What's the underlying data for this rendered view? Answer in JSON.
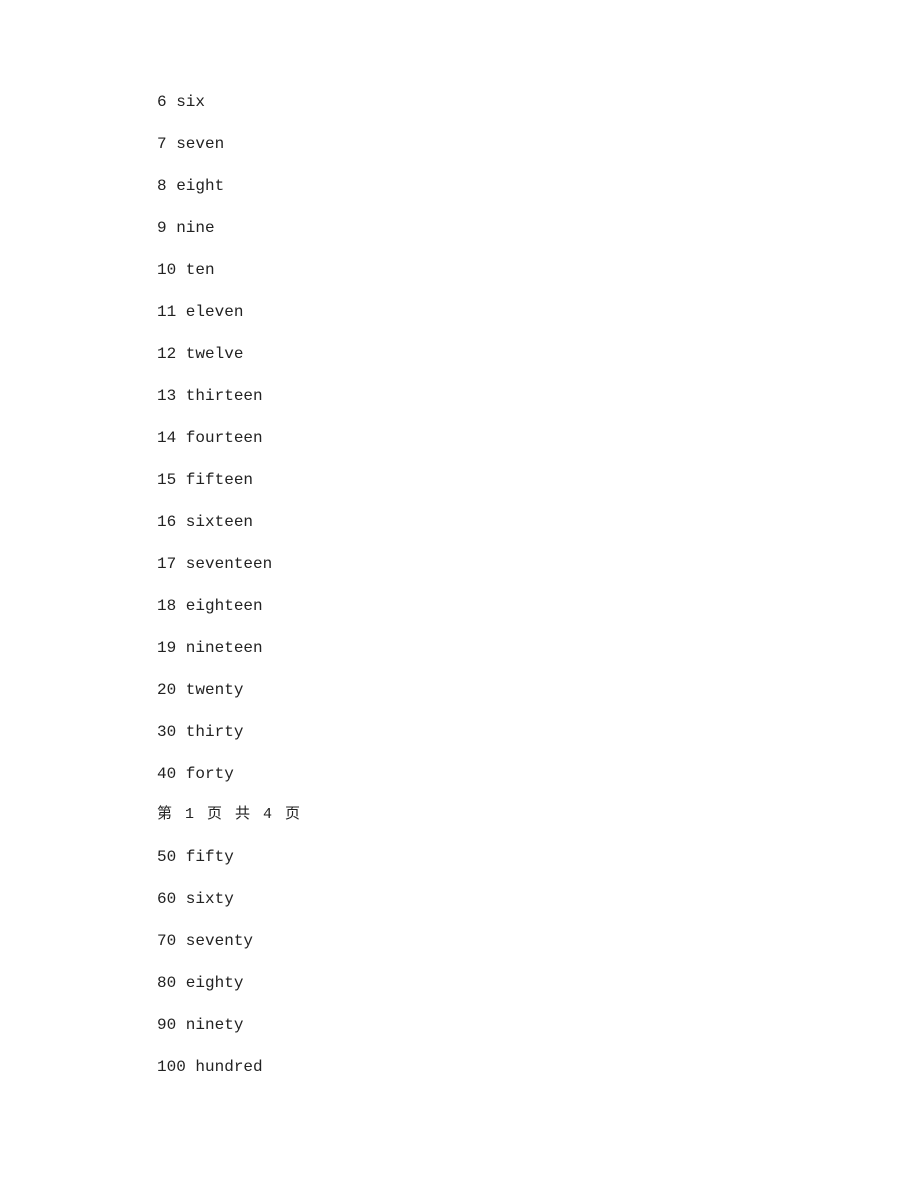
{
  "items": [
    {
      "number": "6",
      "word": "six"
    },
    {
      "number": "7",
      "word": "seven"
    },
    {
      "number": "8",
      "word": "eight"
    },
    {
      "number": "9",
      "word": "nine"
    },
    {
      "number": "10",
      "word": "ten"
    },
    {
      "number": "11",
      "word": "eleven"
    },
    {
      "number": "12",
      "word": "twelve"
    },
    {
      "number": "13",
      "word": "thirteen"
    },
    {
      "number": "14",
      "word": "fourteen"
    },
    {
      "number": "15",
      "word": "fifteen"
    },
    {
      "number": "16",
      "word": "sixteen"
    },
    {
      "number": "17",
      "word": "seventeen"
    },
    {
      "number": "18",
      "word": "eighteen"
    },
    {
      "number": "19",
      "word": "nineteen"
    },
    {
      "number": "20",
      "word": "twenty"
    },
    {
      "number": "30",
      "word": "thirty"
    },
    {
      "number": "40",
      "word": "forty"
    }
  ],
  "page_note": "第 1 页 共 4 页",
  "items_after": [
    {
      "number": "50",
      "word": "fifty"
    },
    {
      "number": "60",
      "word": "sixty"
    },
    {
      "number": "70",
      "word": "seventy"
    },
    {
      "number": "80",
      "word": "eighty"
    },
    {
      "number": "90",
      "word": "ninety"
    },
    {
      "number": "100",
      "word": "hundred"
    }
  ]
}
